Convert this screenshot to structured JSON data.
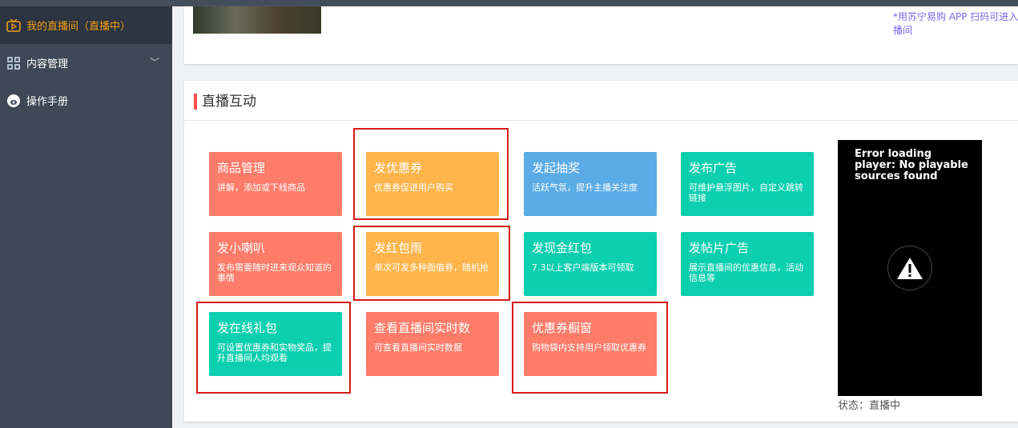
{
  "sidebar": {
    "items": [
      {
        "label": "我的直播间（直播中）",
        "icon": "tv-icon",
        "active": true
      },
      {
        "label": "内容管理",
        "icon": "grid-icon",
        "expandable": true
      },
      {
        "label": "操作手册",
        "icon": "manual-icon"
      }
    ]
  },
  "top_card": {
    "hint": "*用苏宁易购 APP 扫码可进入直播间"
  },
  "section": {
    "title": "直播互动"
  },
  "tiles": [
    {
      "title": "商品管理",
      "desc": "讲解，添加或下线商品",
      "color": "#ff7b6a"
    },
    {
      "title": "发优惠券",
      "desc": "优惠券促进用户购买",
      "color": "#ffb54c"
    },
    {
      "title": "发起抽奖",
      "desc": "活跃气氛，提升主播关注度",
      "color": "#5aabe6"
    },
    {
      "title": "发布广告",
      "desc": "可维护悬浮图片，自定义跳转链接",
      "color": "#0ccfb0"
    },
    {
      "title": "发小喇叭",
      "desc": "发布需要随时进来观众知道的事情",
      "color": "#ff7b6a"
    },
    {
      "title": "发红包雨",
      "desc": "单次可发多种面值券，随机抢",
      "color": "#ffb54c"
    },
    {
      "title": "发现金红包",
      "desc": "7.3以上客户端版本可领取",
      "color": "#0ccfb0"
    },
    {
      "title": "发帖片广告",
      "desc": "展示直播间的优惠信息，活动信息等",
      "color": "#0ccfb0"
    },
    {
      "title": "发在线礼包",
      "desc": "可设置优惠券和实物奖品，提升直播间人均观看",
      "color": "#0ccfb0"
    },
    {
      "title": "查看直播间实时数",
      "desc": "可查看直播间实时数据",
      "color": "#ff7b6a"
    },
    {
      "title": "优惠券橱窗",
      "desc": "购物袋内支持用户领取优惠券",
      "color": "#ff7b6a"
    }
  ],
  "player": {
    "error": "Error loading player: No playable sources found",
    "icon": "warning-icon"
  },
  "status": {
    "text": "状态：直播中"
  }
}
